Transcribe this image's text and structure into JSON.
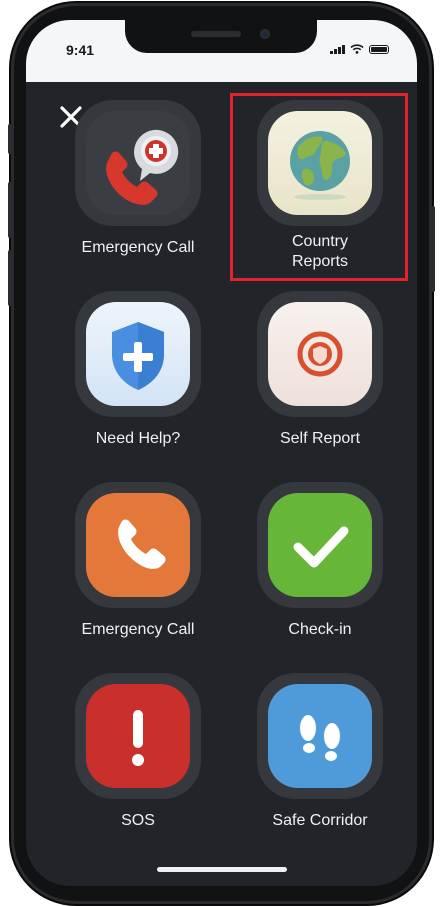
{
  "status_bar": {
    "time": "9:41"
  },
  "close_label": "✕",
  "tiles": [
    {
      "label": "Emergency Call",
      "icon": "phone-with-medical-bubble-icon"
    },
    {
      "label": "Country\nReports",
      "icon": "globe-icon",
      "highlighted": true
    },
    {
      "label": "Need Help?",
      "icon": "shield-plus-icon"
    },
    {
      "label": "Self Report",
      "icon": "shield-badge-icon"
    },
    {
      "label": "Emergency Call",
      "icon": "phone-icon"
    },
    {
      "label": "Check-in",
      "icon": "checkmark-icon"
    },
    {
      "label": "SOS",
      "icon": "exclamation-icon"
    },
    {
      "label": "Safe Corridor",
      "icon": "footprints-icon"
    }
  ],
  "colors": {
    "screen_bg": "#212428",
    "tile_ring": "#35383d",
    "highlight_border": "#e2232a",
    "emergency_orange": "#e3783a",
    "checkin_green": "#66b737",
    "sos_red": "#c9302b",
    "corridor_blue": "#4f9ad8"
  }
}
